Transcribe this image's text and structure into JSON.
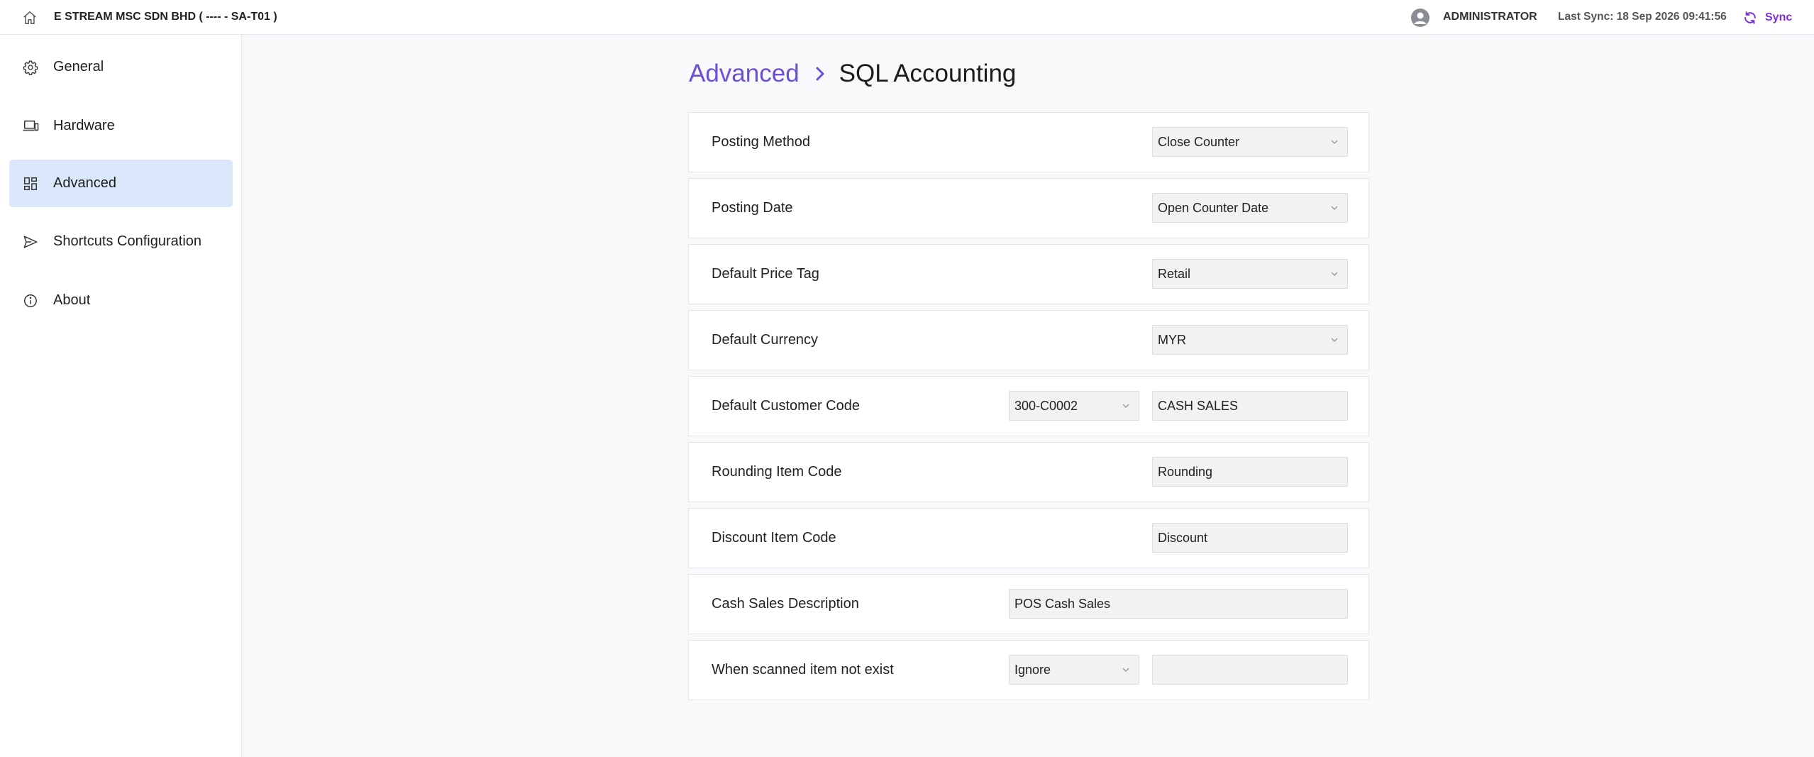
{
  "topbar": {
    "company": "E STREAM MSC SDN BHD ( ---- - SA-T01 )",
    "user": "ADMINISTRATOR",
    "last_sync": "Last Sync: 18 Sep 2026 09:41:56",
    "sync_label": "Sync",
    "icons": [
      "home-icon",
      "user-avatar-icon",
      "sync-icon"
    ],
    "accent": "#7b2fe0"
  },
  "sidebar": {
    "items": [
      {
        "label": "General",
        "icon": "gear-icon"
      },
      {
        "label": "Hardware",
        "icon": "devices-icon"
      },
      {
        "label": "Advanced",
        "icon": "dashboard-icon",
        "active": true
      },
      {
        "label": "Shortcuts Configuration",
        "icon": "send-icon"
      },
      {
        "label": "About",
        "icon": "info-icon"
      }
    ],
    "active_bg": "#dbe8fb"
  },
  "breadcrumb": {
    "parent": "Advanced",
    "current": "SQL Accounting",
    "parent_color": "#6c4fd6"
  },
  "settings": {
    "posting_method": {
      "label": "Posting Method",
      "value": "Close Counter"
    },
    "posting_date": {
      "label": "Posting Date",
      "value": "Open Counter Date"
    },
    "default_price_tag": {
      "label": "Default Price Tag",
      "value": "Retail"
    },
    "default_currency": {
      "label": "Default Currency",
      "value": "MYR"
    },
    "default_customer_code": {
      "label": "Default Customer Code",
      "code": "300-C0002",
      "name": "CASH SALES"
    },
    "rounding_item_code": {
      "label": "Rounding Item Code",
      "value": "Rounding"
    },
    "discount_item_code": {
      "label": "Discount Item Code",
      "value": "Discount"
    },
    "cash_sales_description": {
      "label": "Cash Sales Description",
      "value": "POS Cash Sales"
    },
    "scanned_item_not_exist": {
      "label": "When scanned item not exist",
      "action": "Ignore",
      "extra": ""
    }
  }
}
